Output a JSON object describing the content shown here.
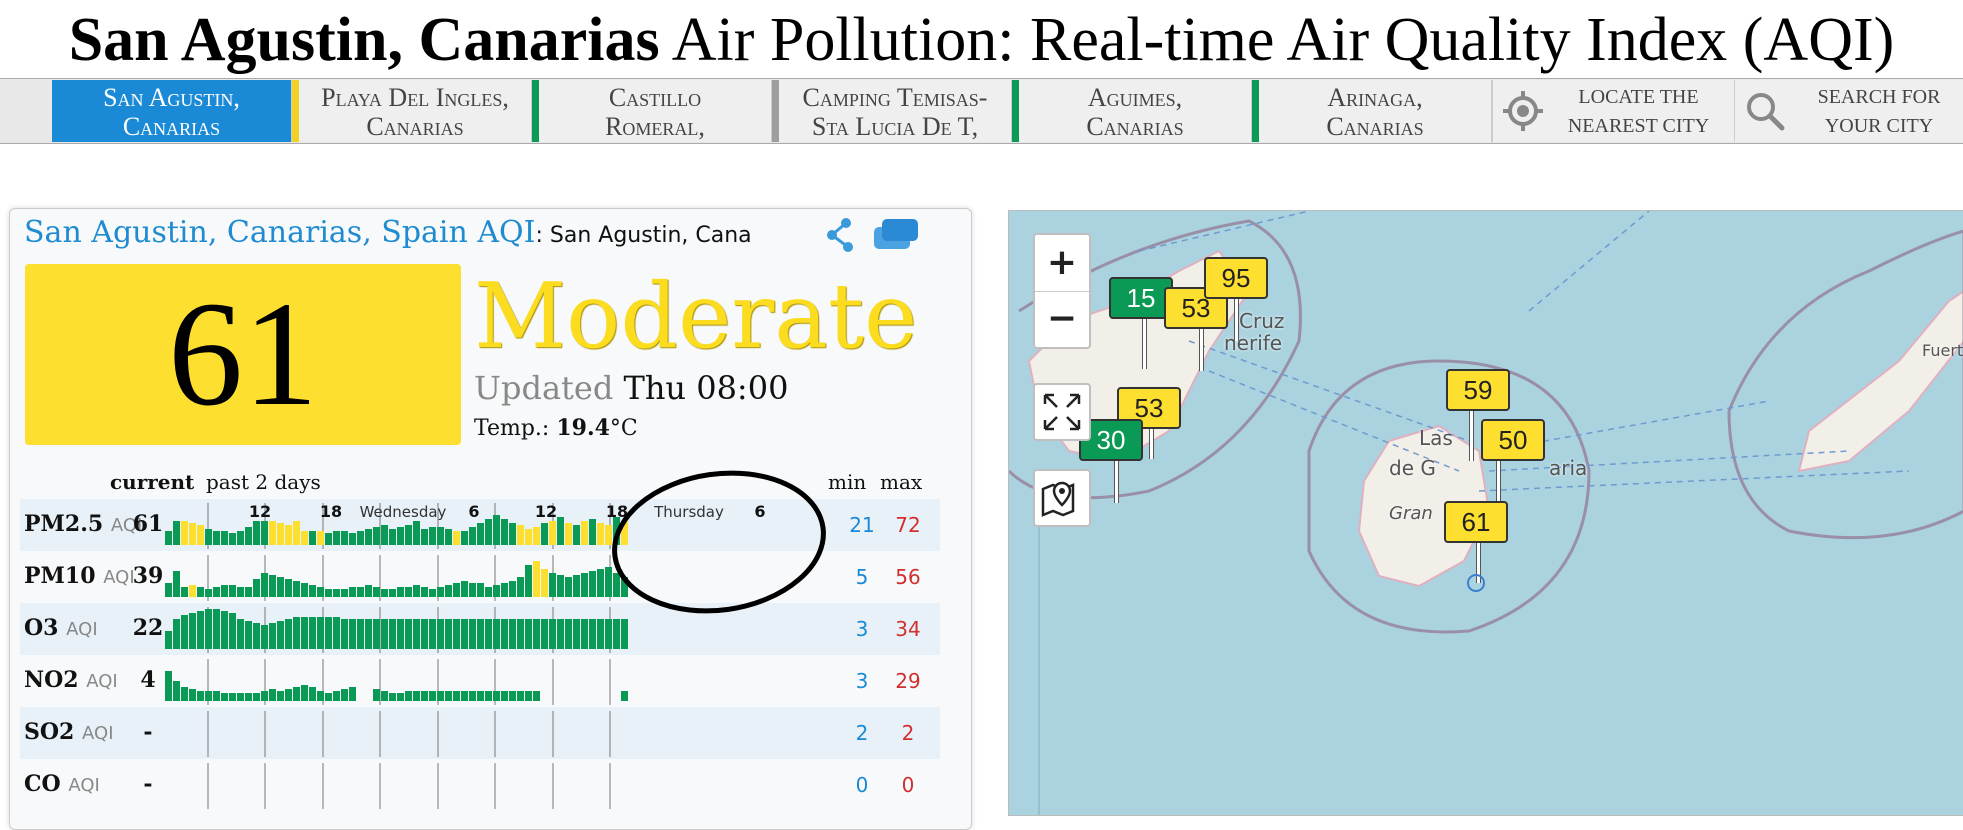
{
  "page_title": {
    "bold": "San Agustin, Canarias",
    "rest": " Air Pollution: Real-time Air Quality Index (AQI)"
  },
  "nav_tabs": [
    {
      "line1": "San Agustin,",
      "line2": "Canarias",
      "color": "#1a8ad6"
    },
    {
      "line1": "Playa Del Ingles,",
      "line2": "Canarias",
      "color": "#f2d024"
    },
    {
      "line1": "Castillo",
      "line2": "Romeral,",
      "color": "#0a9a55"
    },
    {
      "line1": "Camping Temisas-",
      "line2": "Sta Lucia De T,",
      "color": "#9e9e9e"
    },
    {
      "line1": "Aguimes,",
      "line2": "Canarias",
      "color": "#0a9a55"
    },
    {
      "line1": "Arinaga,",
      "line2": "Canarias",
      "color": "#0a9a55"
    }
  ],
  "locate": {
    "line1": "LOCATE THE",
    "line2": "NEAREST CITY",
    "icon": "crosshair-icon"
  },
  "search": {
    "line1": "SEARCH FOR",
    "line2": "YOUR CITY",
    "icon": "search-icon"
  },
  "station": {
    "name": "San Agustin, Canarias, Spain",
    "aqi_label": "AQI",
    "sub": ": San Agustin, Cana"
  },
  "aqi": {
    "value": "61",
    "level": "Moderate",
    "updated_label": "Updated",
    "updated_time": "Thu 08:00",
    "temp_label": "Temp.: ",
    "temp_value": "19.4",
    "temp_unit": "°C"
  },
  "table": {
    "current_label": "current",
    "history_label": "past 2 days",
    "min_label": "min",
    "max_label": "max",
    "time_labels": [
      "12",
      "18",
      "Wednesday",
      "6",
      "12",
      "18",
      "Thursday",
      "6"
    ],
    "aqi_tag": "AQI"
  },
  "pollutants": [
    {
      "name": "PM2.5",
      "current": "61",
      "min": "21",
      "max": "72"
    },
    {
      "name": "PM10",
      "current": "39",
      "min": "5",
      "max": "56"
    },
    {
      "name": "O3",
      "current": "22",
      "min": "3",
      "max": "34"
    },
    {
      "name": "NO2",
      "current": "4",
      "min": "3",
      "max": "29"
    },
    {
      "name": "SO2",
      "current": "-",
      "min": "2",
      "max": "2"
    },
    {
      "name": "CO",
      "current": "-",
      "min": "0",
      "max": "0"
    }
  ],
  "map": {
    "zoom_in": "+",
    "zoom_out": "−",
    "labels": [
      "Cruz",
      "nerife",
      "Las",
      "de G",
      "aria",
      "Gran",
      "Fuert"
    ],
    "markers": [
      "15",
      "53",
      "95",
      "53",
      "30",
      "59",
      "50",
      "61"
    ]
  },
  "colors": {
    "good": "#0a9a55",
    "moderate": "#fcdf2f",
    "accent": "#1a8ad6"
  }
}
